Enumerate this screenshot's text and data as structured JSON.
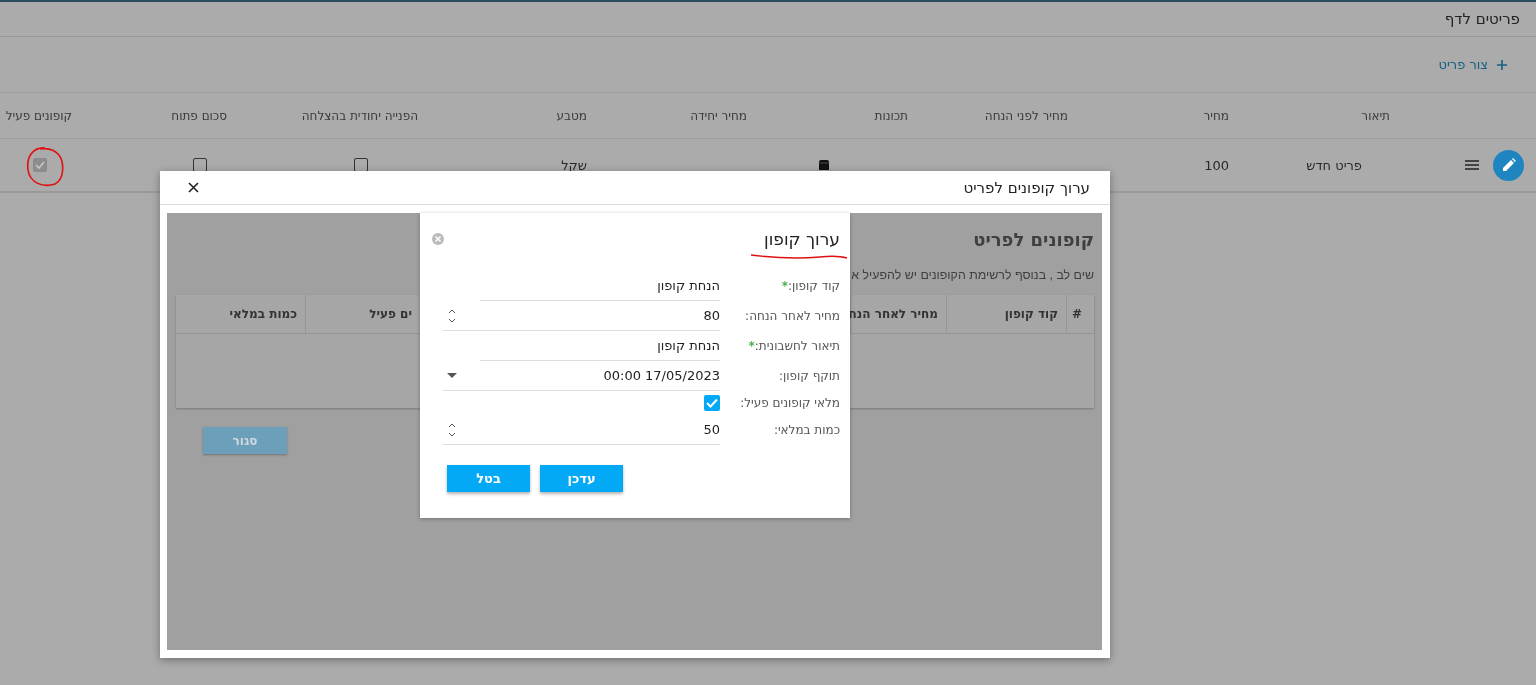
{
  "page": {
    "title": "פריטים לדף",
    "create_button": "צור פריט"
  },
  "items_table": {
    "columns": [
      "תיאור",
      "מחיר",
      "מחיר לפני הנחה",
      "תכונות",
      "מחיר יחידה",
      "מטבע",
      "הפנייה יחודית בהצלחה",
      "סכום פתוח",
      "קופונים פעיל"
    ],
    "rows": [
      {
        "description": "פריט חדש",
        "price": "100",
        "price_before_discount": "",
        "unit_price": "",
        "currency": "שקל",
        "unique_referral": {
          "checked": false,
          "disabled": false
        },
        "open_amount": {
          "checked": false,
          "disabled": false
        },
        "coupons_active": {
          "checked": true,
          "disabled": true
        }
      }
    ]
  },
  "dialog": {
    "title": "ערוך קופונים לפריט",
    "heading": "קופונים לפריט",
    "note": "שים לב , בנוסף לרשימת הקופונים יש להפעיל א",
    "columns": [
      "#",
      "קוד קופון",
      "מחיר לאחר הנח",
      "ים פעיל",
      "כמות במלאי"
    ],
    "close_button": "סגור"
  },
  "coupon_form": {
    "title": "ערוך קופון",
    "fields": [
      {
        "kind": "text",
        "label": "קוד קופון:",
        "required_mark": "*",
        "value": "הנחת קופון"
      },
      {
        "kind": "number",
        "label": "מחיר לאחר הנחה:",
        "value": "80"
      },
      {
        "kind": "text",
        "label": "תיאור לחשבונית:",
        "required_mark": "*",
        "value": "הנחת קופון"
      },
      {
        "kind": "date",
        "label": "תוקף קופון:",
        "value": "00:00 17/05/2023"
      },
      {
        "kind": "checkbox",
        "label": "מלאי קופונים פעיל:",
        "checked": true
      },
      {
        "kind": "number",
        "label": "כמות במלאי:",
        "value": "50"
      }
    ],
    "buttons": [
      "עדכן",
      "בטל"
    ]
  }
}
